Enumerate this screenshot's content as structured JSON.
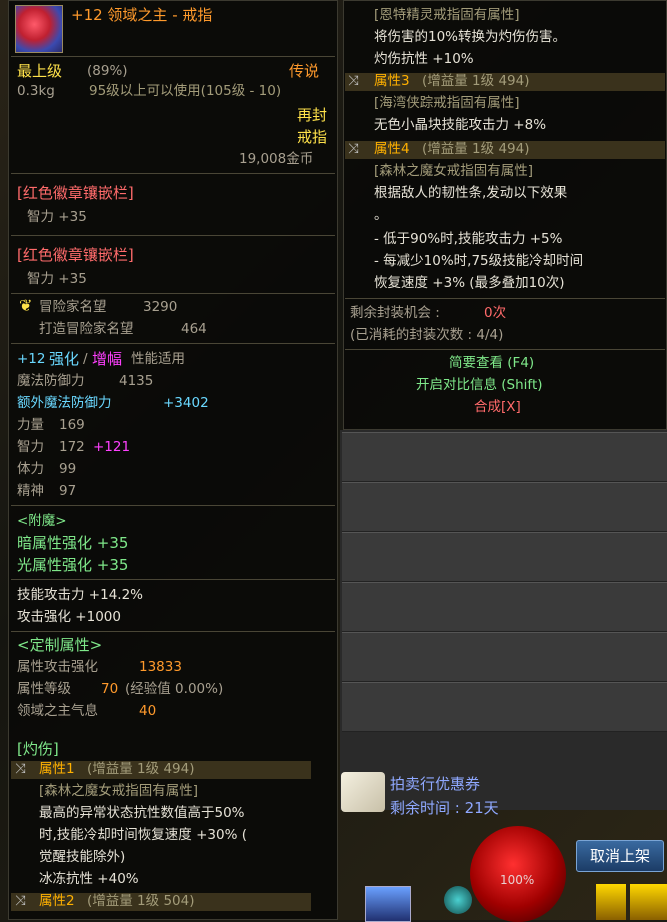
{
  "item": {
    "name": "+12 领域之主 - 戒指",
    "grade": "最上级",
    "grade_percent": "(89%)",
    "rarity": "传说",
    "weight": "0.3kg",
    "level_req": "95级以上可以使用(105级 - 10)",
    "reseal_line1": "再封",
    "reseal_line2": "戒指",
    "price": "19,008金币"
  },
  "badges": [
    {
      "title": "[红色徽章镶嵌栏]",
      "stat": "智力 +35"
    },
    {
      "title": "[红色徽章镶嵌栏]",
      "stat": "智力 +35"
    }
  ],
  "adventurer": {
    "reputation_label": "冒险家名望",
    "reputation_value": "3290",
    "forge_label": "打造冒险家名望",
    "forge_value": "464"
  },
  "enhance": {
    "prefix": "+12",
    "reinforce": "强化",
    "slash": "/",
    "amplify": "增幅",
    "suffix": "性能适用"
  },
  "stats": [
    {
      "label": "魔法防御力",
      "value": "4135",
      "bonus": ""
    },
    {
      "label": "额外魔法防御力",
      "value": "+3402",
      "bonus": ""
    },
    {
      "label": "力量",
      "value": "169",
      "bonus": ""
    },
    {
      "label": "智力",
      "value": "172",
      "bonus": "+121"
    },
    {
      "label": "体力",
      "value": "99",
      "bonus": ""
    },
    {
      "label": "精神",
      "value": "97",
      "bonus": ""
    }
  ],
  "enchant": {
    "title": "<附魔>",
    "lines": [
      "暗属性强化 +35",
      "光属性强化 +35"
    ]
  },
  "skill_lines": [
    "技能攻击力 +14.2%",
    "攻击强化 +1000"
  ],
  "custom": {
    "title": "<定制属性>",
    "attr_attack_label": "属性攻击强化",
    "attr_attack_value": "13833",
    "attr_level_label": "属性等级",
    "attr_level_value": "70",
    "attr_level_exp": "(经验值 0.00%)",
    "aura_label": "领域之主气息",
    "aura_value": "40"
  },
  "burn": {
    "title": "[灼伤]",
    "attr1_label": "属性1",
    "attr1_detail": "(增益量 1级 494)",
    "attr1_source": "[森林之魔女戒指固有属性]",
    "attr1_desc": [
      "最高的异常状态抗性数值高于50%",
      "时,技能冷却时间恢复速度 +30% (",
      "觉醒技能除外)",
      "冰冻抗性 +40%"
    ],
    "attr2_label": "属性2",
    "attr2_detail": "(增益量 1级 504)"
  },
  "right": {
    "source0": "[恩特精灵戒指固有属性]",
    "source0_lines": [
      "将伤害的10%转换为灼伤伤害。",
      "灼伤抗性 +10%"
    ],
    "attr3_label": "属性3",
    "attr3_detail": "(增益量 1级 494)",
    "attr3_source": "[海湾侠踪戒指固有属性]",
    "attr3_line": "无色小晶块技能攻击力 +8%",
    "attr4_label": "属性4",
    "attr4_detail": "(增益量 1级 494)",
    "attr4_source": "[森林之魔女戒指固有属性]",
    "attr4_lines": [
      "根据敌人的韧性条,发动以下效果",
      "。",
      "- 低于90%时,技能攻击力 +5%",
      "- 每减少10%时,75级技能冷却时间",
      "恢复速度 +3% (最多叠加10次)"
    ],
    "seal_remaining_label": "剩余封装机会 :",
    "seal_remaining_value": "0次",
    "seal_used": "(已消耗的封装次数 : 4/4)",
    "brief_view": "简要查看 (F4)",
    "compare": "开启对比信息 (Shift)",
    "synth": "合成[X]"
  },
  "auction": {
    "coupon": "拍卖行优惠券",
    "remaining": "剩余时间 : 21天",
    "cancel_button": "取消上架"
  },
  "hud": {
    "hp_percent": "100%"
  }
}
